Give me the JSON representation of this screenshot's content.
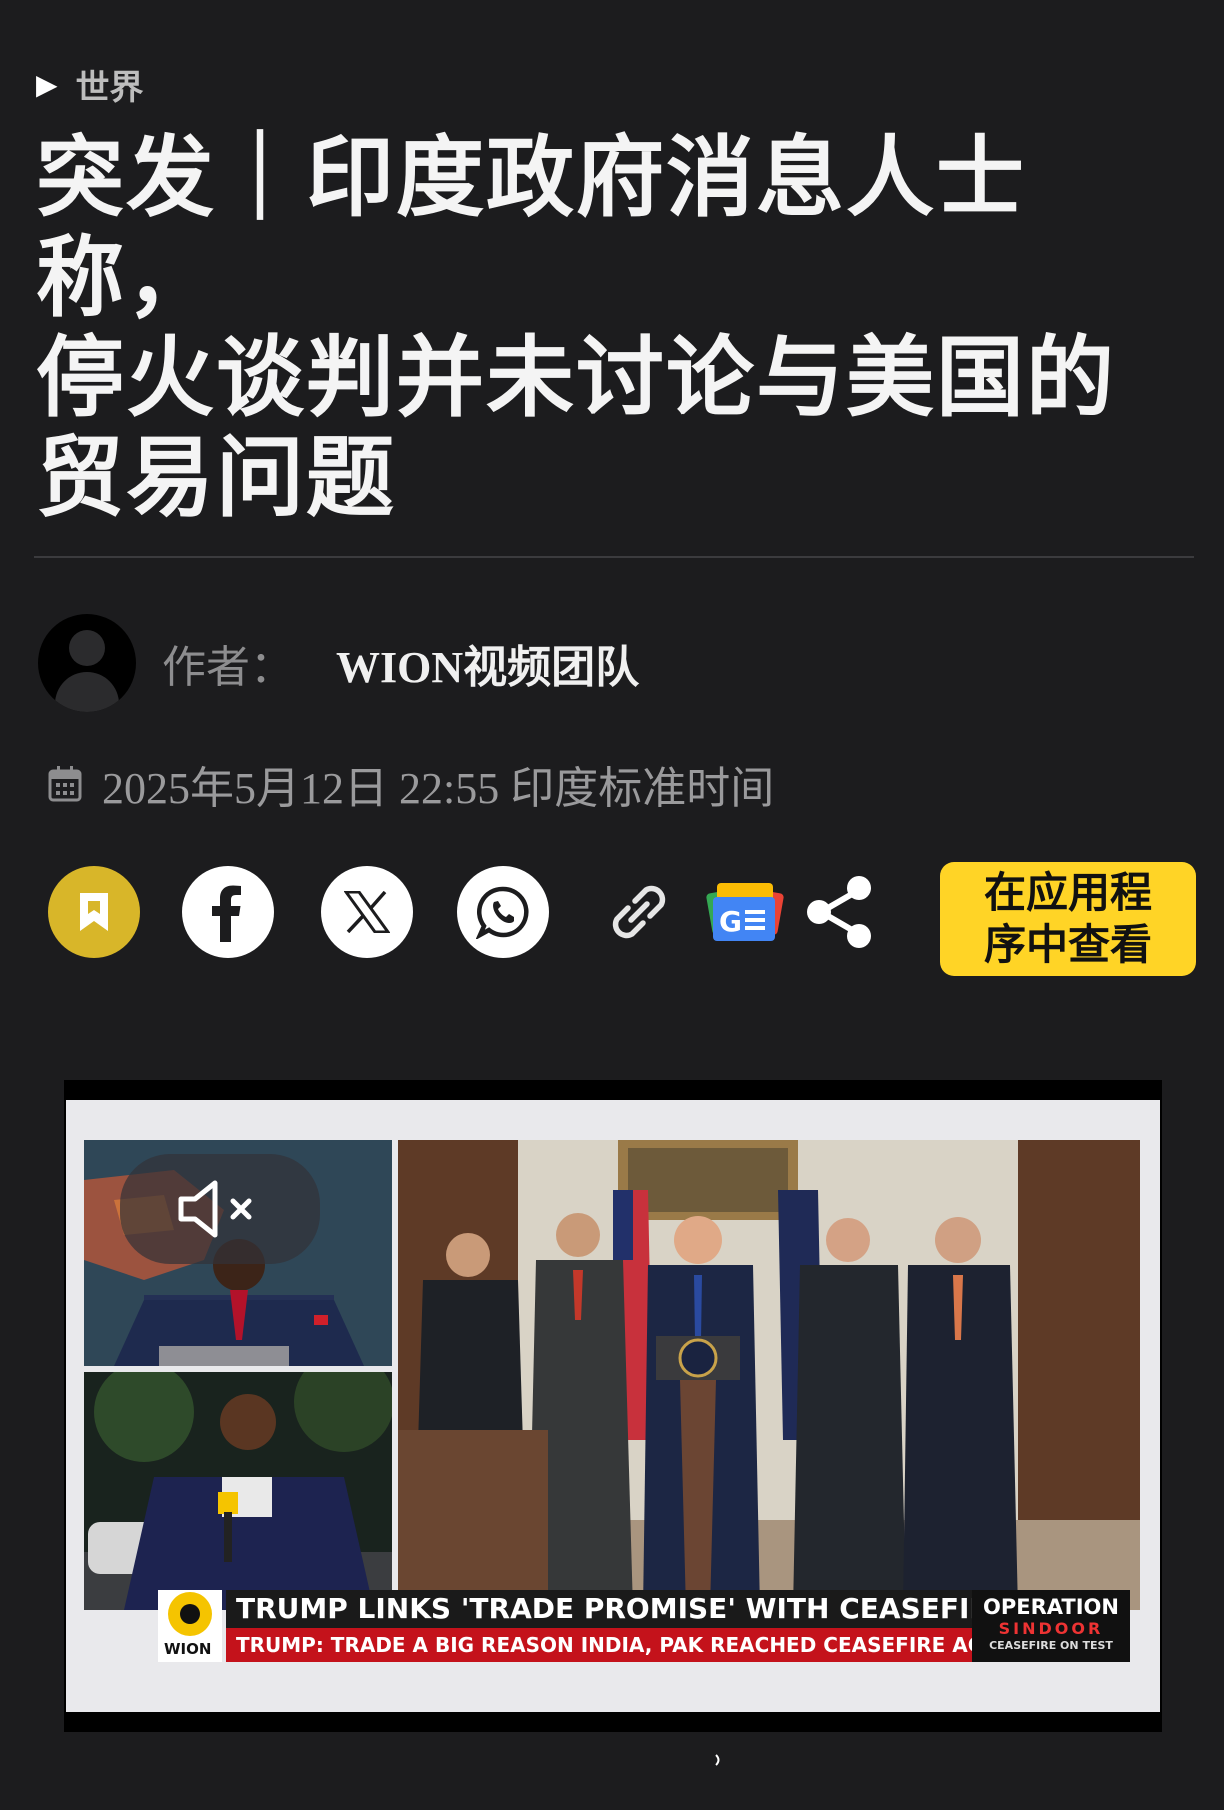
{
  "breadcrumb": {
    "arrow": "▶",
    "section": "世界"
  },
  "article": {
    "headline_lines": [
      "突发｜印度政府消息人士称，",
      "停火谈判并未讨论与美国的",
      "贸易问题"
    ]
  },
  "author": {
    "label": "作者：",
    "name": "WION视频团队"
  },
  "date": {
    "text": "2025年5月12日 22:55 印度标准时间"
  },
  "share": {
    "icons": [
      "bookmark-icon",
      "facebook-icon",
      "x-icon",
      "whatsapp-icon",
      "link-icon",
      "google-news-icon",
      "share-icon"
    ],
    "open_in_app": "在应用程序中查看"
  },
  "video": {
    "ticker_headline": "TRUMP LINKS 'TRADE PROMISE' WITH CEASEFIRE",
    "ticker_sub": "TRUMP: TRADE A BIG REASON INDIA, PAK REACHED CEASEFIRE AGREEMENT",
    "operation_title": "OPERATION",
    "operation_name": "SINDOOR",
    "operation_sub": "CEASEFIRE ON TEST",
    "channel": "WION",
    "muted": true
  },
  "colors": {
    "background": "#1c1c1e",
    "bookmark": "#d8b629",
    "app_button": "#ffd426",
    "ticker_red": "#c4121b"
  }
}
